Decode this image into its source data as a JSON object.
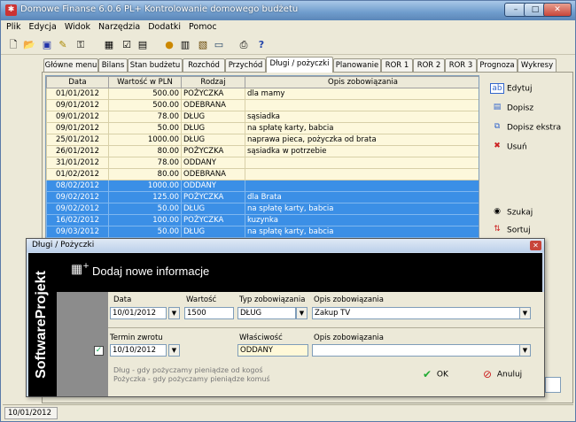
{
  "window": {
    "title": "Domowe Finanse 6.0.6 PL+   Kontrolowanie domowego budżetu",
    "minimize": "–",
    "maximize": "□",
    "close": "✕"
  },
  "menu": [
    "Plik",
    "Edycja",
    "Widok",
    "Narzędzia",
    "Dodatki",
    "Pomoc"
  ],
  "toolbar_icons": [
    "new-icon",
    "open-icon",
    "save-icon",
    "edit-icon",
    "key-icon",
    "calc-icon",
    "check-icon",
    "filter-icon",
    "coins-icon",
    "grid-icon",
    "report-icon",
    "monitor-icon",
    "print-icon",
    "help-icon"
  ],
  "tabs": [
    "Główne menu",
    "Bilans",
    "Stan budżetu",
    "Rozchód",
    "Przychód",
    "Długi / pożyczki",
    "Planowanie",
    "ROR 1",
    "ROR 2",
    "ROR 3",
    "Prognoza",
    "Wykresy"
  ],
  "active_tab_index": 5,
  "table": {
    "headers": [
      "Data",
      "Wartość w PLN",
      "Rodzaj",
      "Opis zobowiązania"
    ],
    "rows": [
      {
        "date": "01/01/2012",
        "value": "500.00",
        "type": "POŻYCZKA",
        "desc": "dla mamy",
        "selected": false
      },
      {
        "date": "09/01/2012",
        "value": "500.00",
        "type": "ODEBRANA",
        "desc": "",
        "selected": false
      },
      {
        "date": "09/01/2012",
        "value": "78.00",
        "type": "DŁUG",
        "desc": "sąsiadka",
        "selected": false
      },
      {
        "date": "09/01/2012",
        "value": "50.00",
        "type": "DŁUG",
        "desc": "na spłatę karty, babcia",
        "selected": false
      },
      {
        "date": "25/01/2012",
        "value": "1000.00",
        "type": "DŁUG",
        "desc": "naprawa pieca, pożyczka od brata",
        "selected": false
      },
      {
        "date": "26/01/2012",
        "value": "80.00",
        "type": "POŻYCZKA",
        "desc": "sąsiadka w potrzebie",
        "selected": false
      },
      {
        "date": "31/01/2012",
        "value": "78.00",
        "type": "ODDANY",
        "desc": "",
        "selected": false
      },
      {
        "date": "01/02/2012",
        "value": "80.00",
        "type": "ODEBRANA",
        "desc": "",
        "selected": false
      },
      {
        "date": "08/02/2012",
        "value": "1000.00",
        "type": "ODDANY",
        "desc": "",
        "selected": true
      },
      {
        "date": "09/02/2012",
        "value": "125.00",
        "type": "POŻYCZKA",
        "desc": "dla Brata",
        "selected": true
      },
      {
        "date": "09/02/2012",
        "value": "50.00",
        "type": "DŁUG",
        "desc": "na spłatę karty, babcia",
        "selected": true
      },
      {
        "date": "16/02/2012",
        "value": "100.00",
        "type": "POŻYCZKA",
        "desc": "kuzynka",
        "selected": true
      },
      {
        "date": "09/03/2012",
        "value": "50.00",
        "type": "DŁUG",
        "desc": "na spłatę karty, babcia",
        "selected": true
      }
    ]
  },
  "actions": {
    "edit": "Edytuj",
    "add": "Dopisz",
    "add_extra": "Dopisz ekstra",
    "delete": "Usuń",
    "search": "Szukaj",
    "sort": "Sortuj"
  },
  "status": {
    "date": "10/01/2012"
  },
  "dialog": {
    "title": "Długi / Pożyczki",
    "brand": "SoftwareProjekt",
    "heading": "Dodaj nowe informacje",
    "labels": {
      "date": "Data",
      "value": "Wartość",
      "type": "Typ zobowiązania",
      "desc": "Opis zobowiązania",
      "due": "Termin zwrotu",
      "owner": "Właściwość",
      "desc2": "Opis zobowiązania"
    },
    "values": {
      "date": "10/01/2012",
      "value": "1500",
      "type": "DŁUG",
      "desc": "Zakup TV",
      "due": "10/10/2012",
      "owner": "ODDANY",
      "desc2": ""
    },
    "due_checked": true,
    "hint1": "Dług - gdy pożyczamy pieniądze od kogoś",
    "hint2": "Pożyczka - gdy pożyczamy pieniądze komuś",
    "ok": "OK",
    "cancel": "Anuluj"
  }
}
